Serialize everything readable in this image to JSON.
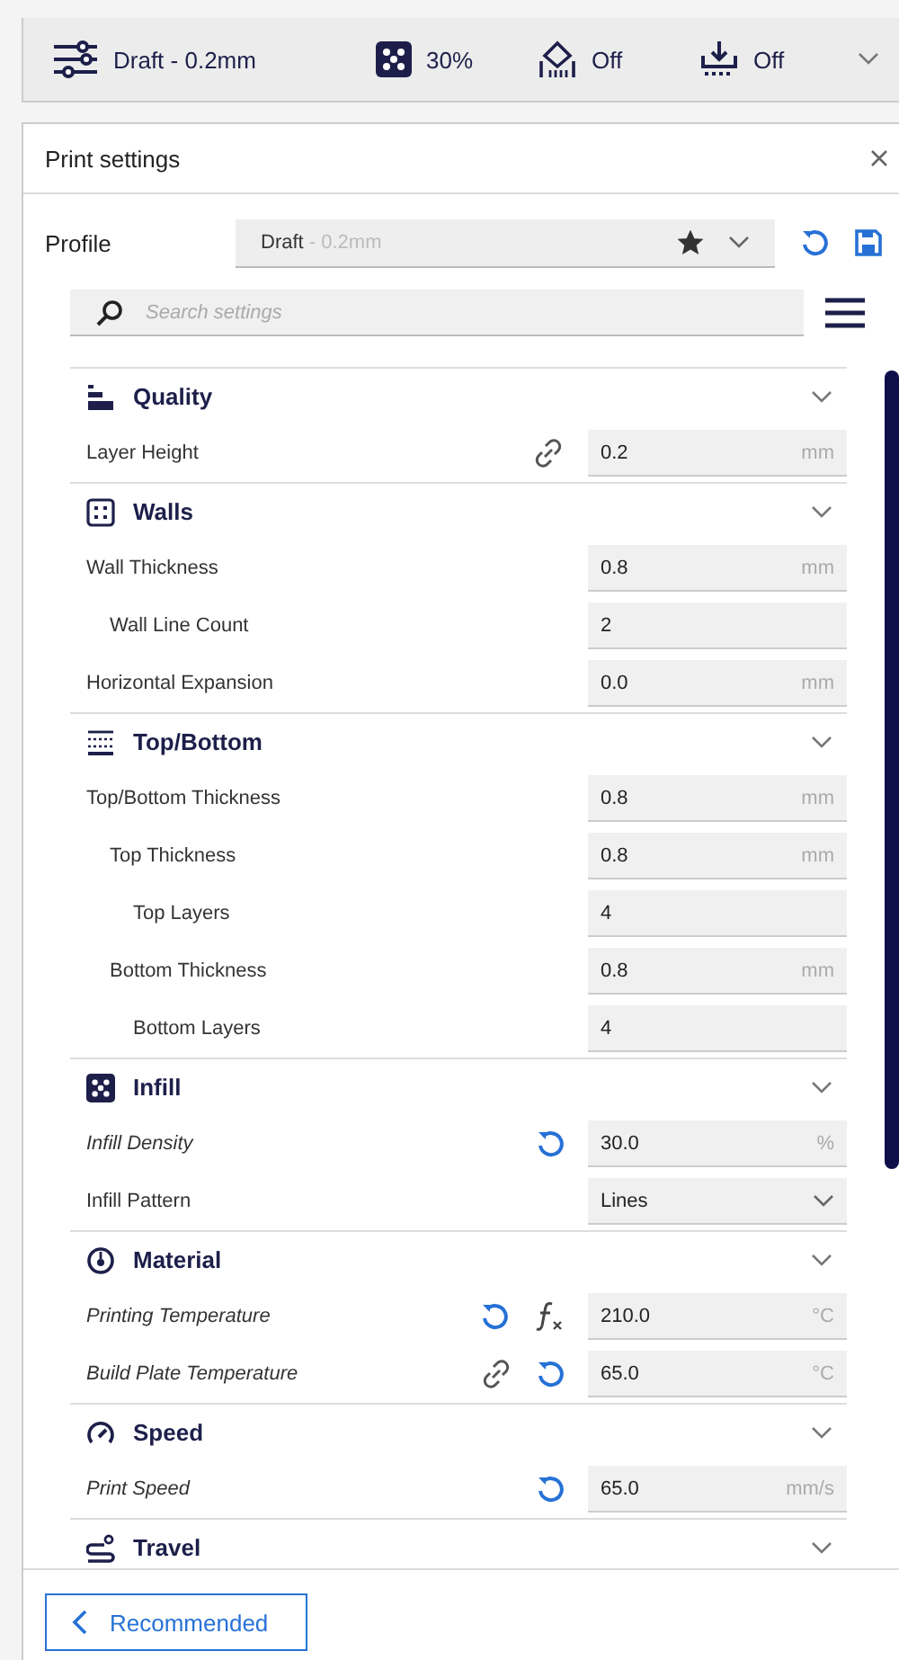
{
  "top_bar": {
    "items": [
      {
        "kind": "profile",
        "text": "Draft - 0.2mm"
      },
      {
        "kind": "infill",
        "text": "30%"
      },
      {
        "kind": "support",
        "text": "Off"
      },
      {
        "kind": "adhesion",
        "text": "Off"
      }
    ]
  },
  "panel": {
    "title": "Print settings",
    "profile": {
      "label": "Profile",
      "name": "Draft",
      "suffix": " - 0.2mm",
      "favorite": true
    },
    "search": {
      "placeholder": "Search settings"
    },
    "sections": [
      {
        "title": "Quality",
        "expanded": true,
        "settings": [
          {
            "label": "Layer Height",
            "modified": false,
            "linked": true,
            "resettable": false,
            "formula": false,
            "kind": "number",
            "value": "0.2",
            "unit": "mm"
          }
        ]
      },
      {
        "title": "Walls",
        "expanded": true,
        "settings": [
          {
            "label": "Wall Thickness",
            "modified": false,
            "kind": "number",
            "value": "0.8",
            "unit": "mm",
            "children": [
              {
                "label": "Wall Line Count",
                "modified": false,
                "kind": "number",
                "value": "2"
              }
            ]
          },
          {
            "label": "Horizontal Expansion",
            "modified": false,
            "kind": "number",
            "value": "0.0",
            "unit": "mm"
          }
        ]
      },
      {
        "title": "Top/Bottom",
        "expanded": true,
        "settings": [
          {
            "label": "Top/Bottom Thickness",
            "modified": false,
            "kind": "number",
            "value": "0.8",
            "unit": "mm",
            "children": [
              {
                "label": "Top Thickness",
                "modified": false,
                "kind": "number",
                "value": "0.8",
                "unit": "mm",
                "children": [
                  {
                    "label": "Top Layers",
                    "modified": false,
                    "kind": "number",
                    "value": "4"
                  }
                ]
              },
              {
                "label": "Bottom Thickness",
                "modified": false,
                "kind": "number",
                "value": "0.8",
                "unit": "mm",
                "children": [
                  {
                    "label": "Bottom Layers",
                    "modified": false,
                    "kind": "number",
                    "value": "4"
                  }
                ]
              }
            ]
          }
        ]
      },
      {
        "title": "Infill",
        "expanded": true,
        "settings": [
          {
            "label": "Infill Density",
            "modified": true,
            "linked": false,
            "resettable": true,
            "formula": false,
            "kind": "number",
            "value": "30.0",
            "unit": "%"
          },
          {
            "label": "Infill Pattern",
            "modified": false,
            "kind": "dropdown",
            "value": "Lines"
          }
        ]
      },
      {
        "title": "Material",
        "expanded": true,
        "settings": [
          {
            "label": "Printing Temperature",
            "modified": true,
            "linked": false,
            "resettable": true,
            "formula": true,
            "kind": "number",
            "value": "210.0",
            "unit": "°C"
          },
          {
            "label": "Build Plate Temperature",
            "modified": true,
            "linked": true,
            "resettable": true,
            "formula": false,
            "kind": "number",
            "value": "65.0",
            "unit": "°C"
          }
        ]
      },
      {
        "title": "Speed",
        "expanded": true,
        "settings": [
          {
            "label": "Print Speed",
            "modified": true,
            "linked": false,
            "resettable": true,
            "formula": false,
            "kind": "number",
            "value": "65.0",
            "unit": "mm/s"
          }
        ]
      },
      {
        "title": "Travel",
        "expanded": true
      }
    ],
    "footer": {
      "button": "Recommended"
    }
  }
}
